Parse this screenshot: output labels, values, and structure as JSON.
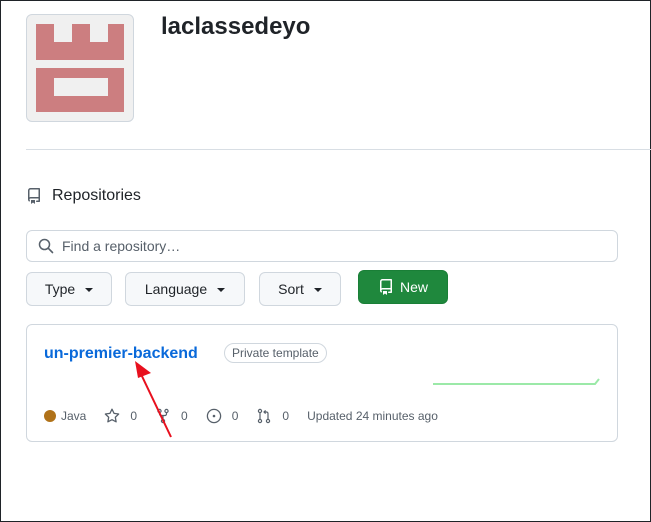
{
  "org": {
    "name": "laclassedeyo"
  },
  "repositories": {
    "title": "Repositories",
    "search": {
      "placeholder": "Find a repository…",
      "value": ""
    },
    "filters": {
      "type": "Type",
      "language": "Language",
      "sort": "Sort"
    },
    "new_button": "New",
    "items": [
      {
        "name": "un-premier-backend",
        "visibility": "Private template",
        "language": "Java",
        "language_color": "#b07219",
        "stars": "0",
        "forks": "0",
        "issues": "0",
        "pull_requests": "0",
        "updated": "Updated 24 minutes ago"
      }
    ]
  },
  "colors": {
    "accent_link": "#0969da",
    "new_button": "#1f883d",
    "avatar": "#cc7e80",
    "annotation_arrow": "#e8101e"
  }
}
